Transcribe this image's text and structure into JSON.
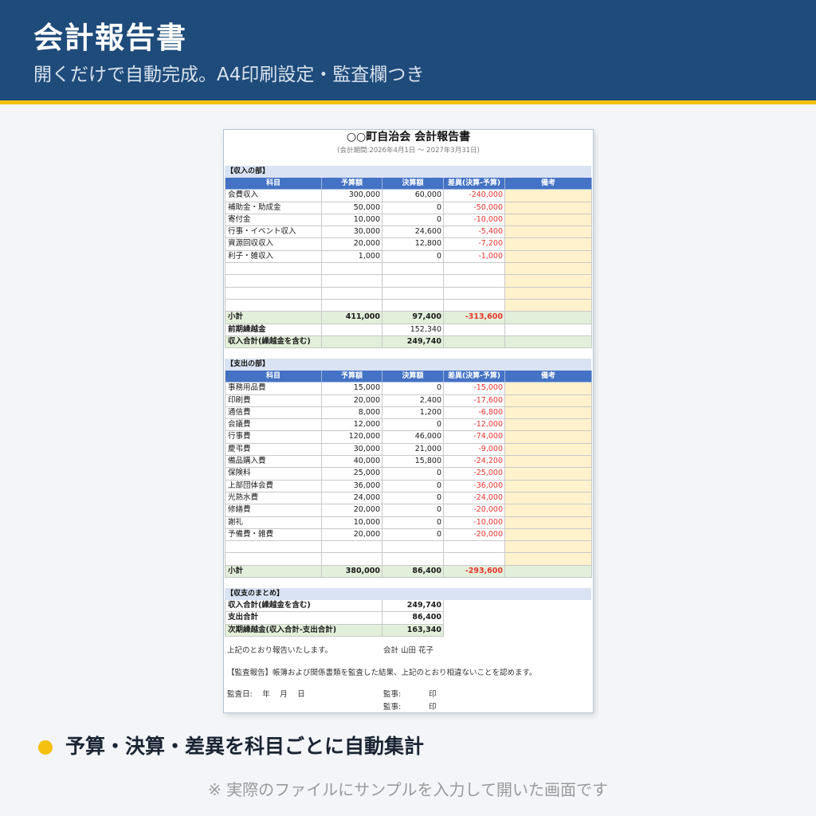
{
  "colors": {
    "page_bg": "#f3f5f9",
    "header_bg": "#1e4b7a",
    "stripe": "#f5c010",
    "section_bg": "#dae3f3",
    "table_header_bg": "#4472c4",
    "subtotal_bg": "#e2efda",
    "note_bg": "#fff2cc",
    "negative": "#e8352f",
    "bullet": "#f5c010"
  },
  "hero": {
    "title": "会計報告書",
    "subtitle": "開くだけで自動完成。A4印刷設定・監査欄つき"
  },
  "document": {
    "title": "○○町自治会 会計報告書",
    "period": "(会計期間:2026年4月1日 〜 2027年3月31日)",
    "columns": [
      "科目",
      "予算額",
      "決算額",
      "差異(決算-予算)",
      "備考"
    ],
    "income": {
      "section_label": "【収入の部】",
      "rows": [
        {
          "item": "会費収入",
          "budget": "300,000",
          "actual": "60,000",
          "diff": "-240,000"
        },
        {
          "item": "補助金・助成金",
          "budget": "50,000",
          "actual": "0",
          "diff": "-50,000"
        },
        {
          "item": "寄付金",
          "budget": "10,000",
          "actual": "0",
          "diff": "-10,000"
        },
        {
          "item": "行事・イベント収入",
          "budget": "30,000",
          "actual": "24,600",
          "diff": "-5,400"
        },
        {
          "item": "資源回収収入",
          "budget": "20,000",
          "actual": "12,800",
          "diff": "-7,200"
        },
        {
          "item": "利子・雑収入",
          "budget": "1,000",
          "actual": "0",
          "diff": "-1,000"
        }
      ],
      "subtotal": {
        "label": "小計",
        "budget": "411,000",
        "actual": "97,400",
        "diff": "-313,600"
      },
      "carryover": {
        "label": "前期繰越金",
        "actual": "152,340"
      },
      "total": {
        "label": "収入合計(繰越金を含む)",
        "actual": "249,740"
      }
    },
    "expense": {
      "section_label": "【支出の部】",
      "rows": [
        {
          "item": "事務用品費",
          "budget": "15,000",
          "actual": "0",
          "diff": "-15,000"
        },
        {
          "item": "印刷費",
          "budget": "20,000",
          "actual": "2,400",
          "diff": "-17,600"
        },
        {
          "item": "通信費",
          "budget": "8,000",
          "actual": "1,200",
          "diff": "-6,800"
        },
        {
          "item": "会議費",
          "budget": "12,000",
          "actual": "0",
          "diff": "-12,000"
        },
        {
          "item": "行事費",
          "budget": "120,000",
          "actual": "46,000",
          "diff": "-74,000"
        },
        {
          "item": "慶弔費",
          "budget": "30,000",
          "actual": "21,000",
          "diff": "-9,000"
        },
        {
          "item": "備品購入費",
          "budget": "40,000",
          "actual": "15,800",
          "diff": "-24,200"
        },
        {
          "item": "保険料",
          "budget": "25,000",
          "actual": "0",
          "diff": "-25,000"
        },
        {
          "item": "上部団体会費",
          "budget": "36,000",
          "actual": "0",
          "diff": "-36,000"
        },
        {
          "item": "光熱水費",
          "budget": "24,000",
          "actual": "0",
          "diff": "-24,000"
        },
        {
          "item": "修繕費",
          "budget": "20,000",
          "actual": "0",
          "diff": "-20,000"
        },
        {
          "item": "謝礼",
          "budget": "10,000",
          "actual": "0",
          "diff": "-10,000"
        },
        {
          "item": "予備費・雑費",
          "budget": "20,000",
          "actual": "0",
          "diff": "-20,000"
        }
      ],
      "subtotal": {
        "label": "小計",
        "budget": "380,000",
        "actual": "86,400",
        "diff": "-293,600"
      }
    },
    "summary": {
      "section_label": "【収支のまとめ】",
      "rows": [
        {
          "label": "収入合計(繰越金を含む)",
          "value": "249,740"
        },
        {
          "label": "支出合計",
          "value": "86,400"
        },
        {
          "label": "次期繰越金(収入合計-支出合計)",
          "value": "163,340"
        }
      ]
    },
    "report_text": "上記のとおり報告いたします。",
    "accountant": "会計 山田 花子",
    "audit_text": "【監査報告】帳簿および関係書類を監査した結果、上記のとおり相違ないことを認めます。",
    "audit_date": "監査日:　 年　 月　 日",
    "auditors": [
      {
        "label": "監事:",
        "seal": "印"
      },
      {
        "label": "監事:",
        "seal": "印"
      }
    ]
  },
  "feature": {
    "text": "予算・決算・差異を科目ごとに自動集計"
  },
  "footnote": "※ 実際のファイルにサンプルを入力して開いた画面です"
}
